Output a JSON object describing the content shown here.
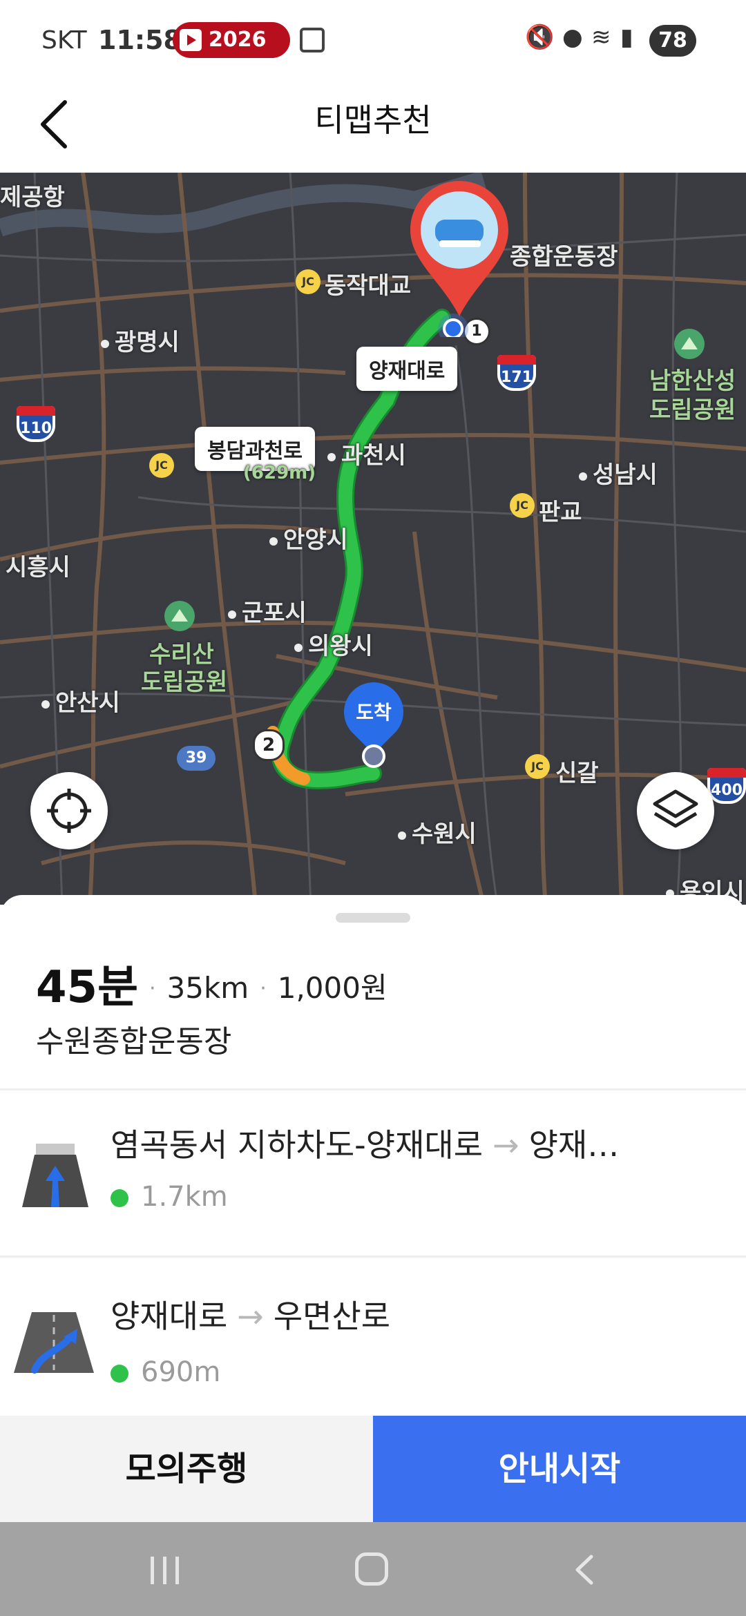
{
  "status_bar": {
    "carrier": "SKT",
    "time": "11:58",
    "recording_label": "2026",
    "battery": "78"
  },
  "header": {
    "title": "티맵추천"
  },
  "map": {
    "route_labels": {
      "yangjae": "양재대로",
      "bongdam": "봉담과천로",
      "bongdam_sub": "(629m)"
    },
    "arrive_label": "도착",
    "waypoints": [
      "1",
      "2"
    ],
    "places": {
      "airport": "제공항",
      "stadium": "종합운동장",
      "dongjak": "동작대교",
      "gwangmyeong": "광명시",
      "namhansan": "남한산성",
      "namhansan2": "도립공원",
      "gwacheon": "과천시",
      "seongnam": "성남시",
      "pangyo": "판교",
      "anyang": "안양시",
      "siheung": "시흥시",
      "gunpo": "군포시",
      "uiwang": "의왕시",
      "surisan": "수리산",
      "surisan2": "도립공원",
      "ansan": "안산시",
      "singal": "신갈",
      "suwon": "수원시",
      "yongin": "용인시"
    },
    "highways": [
      "110",
      "171",
      "39",
      "400"
    ]
  },
  "summary": {
    "duration": "45분",
    "distance": "35km",
    "toll": "1,000원",
    "destination": "수원종합운동장"
  },
  "steps": [
    {
      "from": "염곡동서 지하차도-양재대로",
      "to": "양재…",
      "distance": "1.7km"
    },
    {
      "from": "양재대로",
      "to": "우면산로",
      "distance": "690m"
    }
  ],
  "actions": {
    "simulate": "모의주행",
    "start": "안내시작"
  },
  "colors": {
    "route": "#2ec24a",
    "start_button": "#3a6ff0",
    "map_bg": "#3a3c42"
  }
}
